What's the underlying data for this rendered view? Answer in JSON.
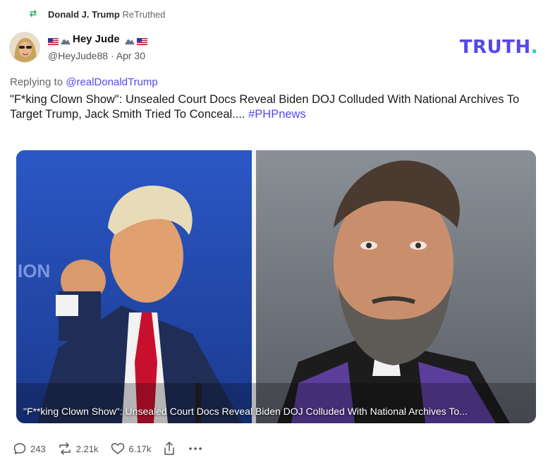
{
  "retruth": {
    "icon": "retruth-icon",
    "user": "Donald J. Trump",
    "suffix": "ReTruthed"
  },
  "author": {
    "display_name": "Hey Jude",
    "handle": "@HeyJude88",
    "separator": "·",
    "date": "Apr 30"
  },
  "brand": {
    "logo_text": "TRUTH",
    "logo_dot": ".",
    "color": "#5448ee",
    "dot_color": "#28d0b0"
  },
  "reply": {
    "prefix": "Replying to",
    "mention": "@realDonaldTrump"
  },
  "post": {
    "text": "\"F*king Clown Show\": Unsealed Court Docs Reveal Biden DOJ Colluded With National Archives To Target Trump, Jack Smith Tried To Conceal....",
    "hashtag": "#PHPnews"
  },
  "media": {
    "caption": "\"F**king Clown Show\": Unsealed Court Docs Reveal Biden DOJ Colluded With National Archives To..."
  },
  "actions": {
    "replies": {
      "icon": "reply-icon",
      "count": "243"
    },
    "retruths": {
      "icon": "retruth-icon",
      "count": "2.21k"
    },
    "likes": {
      "icon": "heart-icon",
      "count": "6.17k"
    },
    "share": {
      "icon": "share-icon"
    },
    "more": {
      "icon": "more-icon"
    }
  },
  "colors": {
    "accent": "#5448ee",
    "retruth_green": "#2fb36b",
    "muted": "#666666"
  }
}
